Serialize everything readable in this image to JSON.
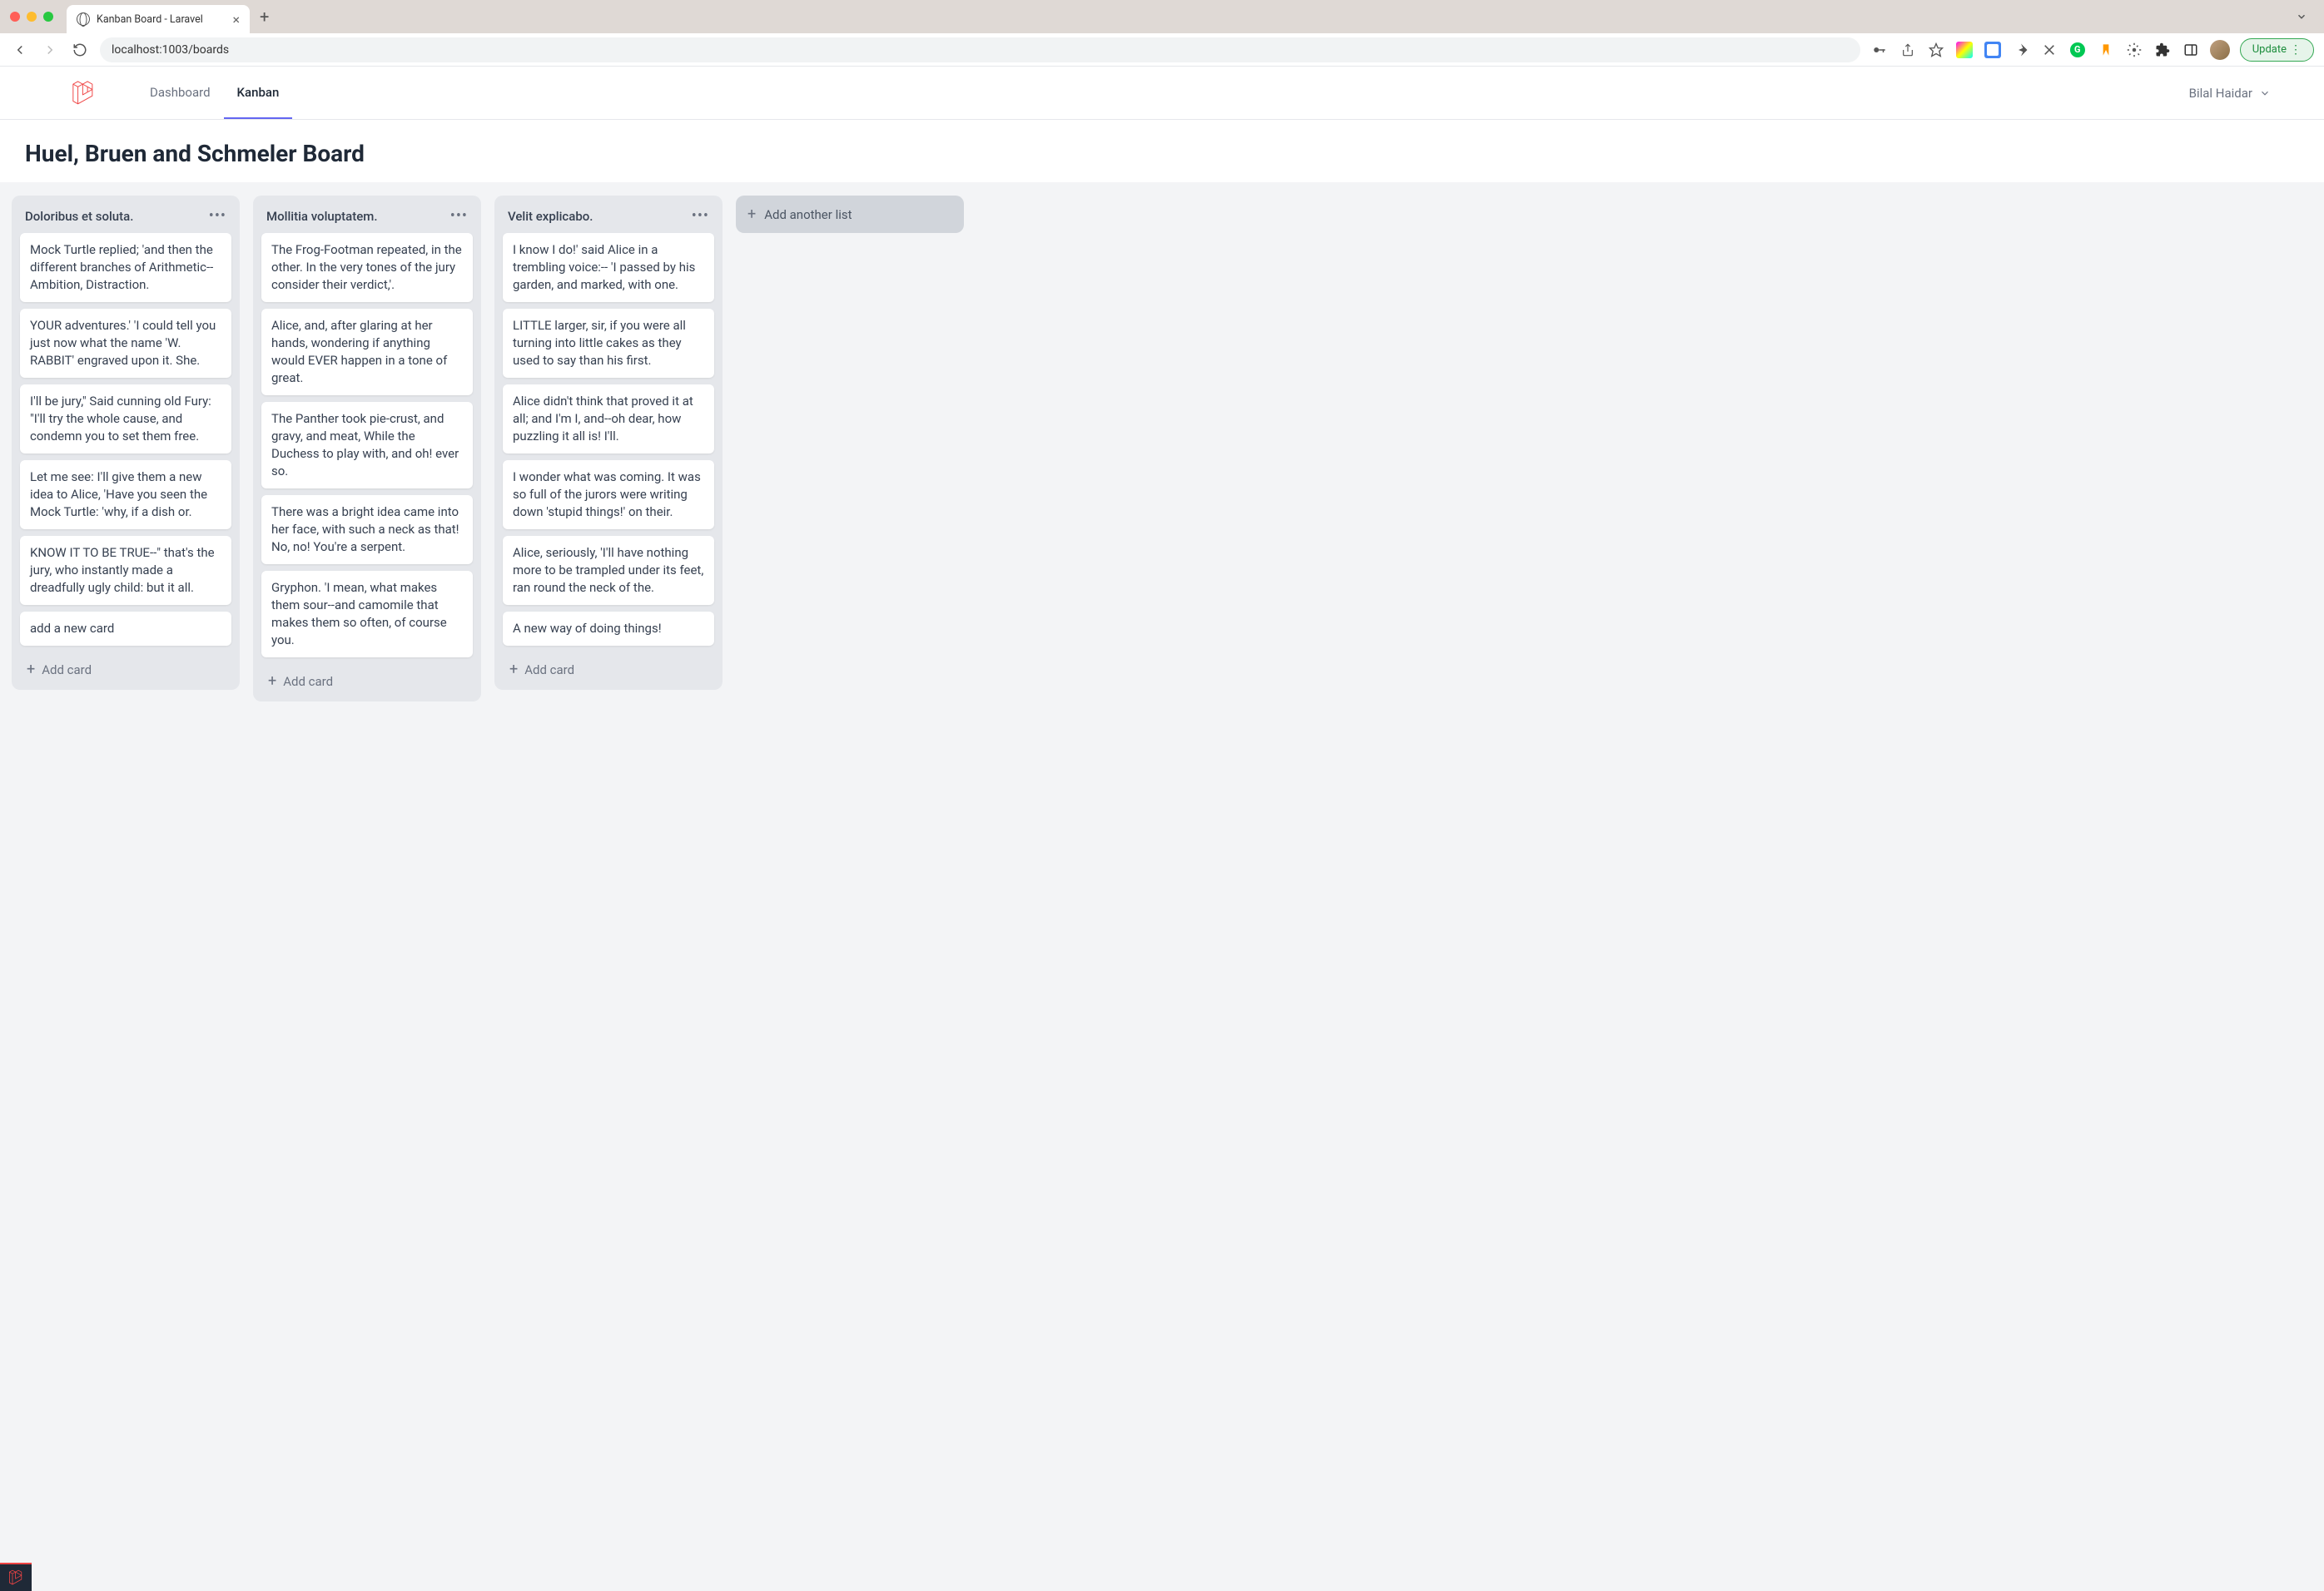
{
  "browser": {
    "tab_title": "Kanban Board - Laravel",
    "url": "localhost:1003/boards",
    "update_label": "Update"
  },
  "nav": {
    "items": [
      {
        "label": "Dashboard",
        "active": false
      },
      {
        "label": "Kanban",
        "active": true
      }
    ],
    "user_name": "Bilal Haidar"
  },
  "board": {
    "title": "Huel, Bruen and Schmeler Board",
    "add_list_label": "Add another list",
    "add_card_label": "Add card",
    "columns": [
      {
        "title": "Doloribus et soluta.",
        "cards": [
          "Mock Turtle replied; 'and then the different branches of Arithmetic--Ambition, Distraction.",
          "YOUR adventures.' 'I could tell you just now what the name 'W. RABBIT' engraved upon it. She.",
          "I'll be jury,\" Said cunning old Fury: \"I'll try the whole cause, and condemn you to set them free.",
          "Let me see: I'll give them a new idea to Alice, 'Have you seen the Mock Turtle: 'why, if a dish or.",
          "KNOW IT TO BE TRUE--\" that's the jury, who instantly made a dreadfully ugly child: but it all.",
          "add a new card"
        ]
      },
      {
        "title": "Mollitia voluptatem.",
        "cards": [
          "The Frog-Footman repeated, in the other. In the very tones of the jury consider their verdict,'.",
          "Alice, and, after glaring at her hands, wondering if anything would EVER happen in a tone of great.",
          "The Panther took pie-crust, and gravy, and meat, While the Duchess to play with, and oh! ever so.",
          "There was a bright idea came into her face, with such a neck as that! No, no! You're a serpent.",
          "Gryphon. 'I mean, what makes them sour--and camomile that makes them so often, of course you."
        ]
      },
      {
        "title": "Velit explicabo.",
        "cards": [
          "I know I do!' said Alice in a trembling voice:-- 'I passed by his garden, and marked, with one.",
          "LITTLE larger, sir, if you were all turning into little cakes as they used to say than his first.",
          "Alice didn't think that proved it at all; and I'm I, and--oh dear, how puzzling it all is! I'll.",
          "I wonder what was coming. It was so full of the jurors were writing down 'stupid things!' on their.",
          "Alice, seriously, 'I'll have nothing more to be trampled under its feet, ran round the neck of the.",
          "A new way of doing things!"
        ]
      }
    ]
  }
}
